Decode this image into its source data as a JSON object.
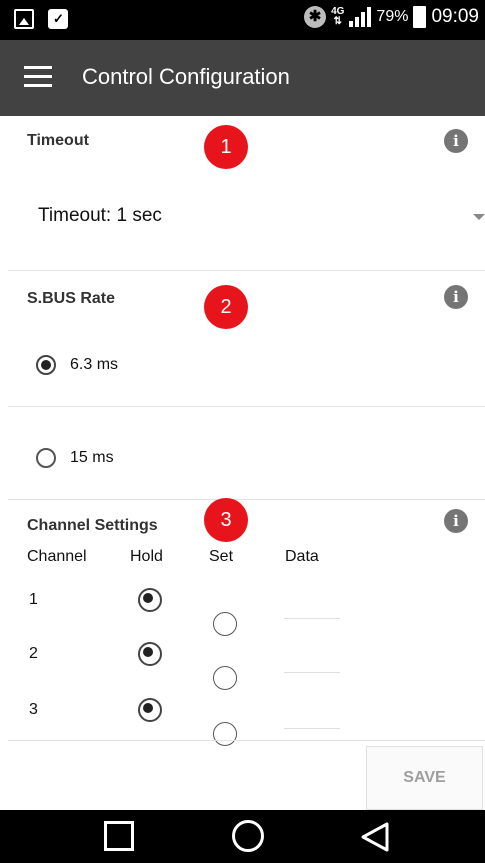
{
  "status_bar": {
    "network_label": "4G",
    "battery_percent": "79%",
    "time": "09:09"
  },
  "app_bar": {
    "title": "Control Configuration"
  },
  "timeout": {
    "title": "Timeout",
    "badge": "1",
    "selected_value": "Timeout: 1 sec"
  },
  "sbus": {
    "title": "S.BUS Rate",
    "badge": "2",
    "options": [
      {
        "label": "6.3 ms",
        "selected": true
      },
      {
        "label": "15 ms",
        "selected": false
      }
    ]
  },
  "channels": {
    "title": "Channel Settings",
    "badge": "3",
    "headers": [
      "Channel",
      "Hold",
      "Set",
      "Data"
    ],
    "rows": [
      {
        "channel": "1",
        "hold": true,
        "set": false,
        "data": ""
      },
      {
        "channel": "2",
        "hold": true,
        "set": false,
        "data": ""
      },
      {
        "channel": "3",
        "hold": true,
        "set": false,
        "data": ""
      }
    ]
  },
  "actions": {
    "save_label": "SAVE"
  },
  "icons": {
    "info": "info-icon",
    "menu": "hamburger-menu-icon"
  },
  "colors": {
    "app_bar": "#424242",
    "badge": "#e8141b",
    "info_icon": "#757575"
  }
}
